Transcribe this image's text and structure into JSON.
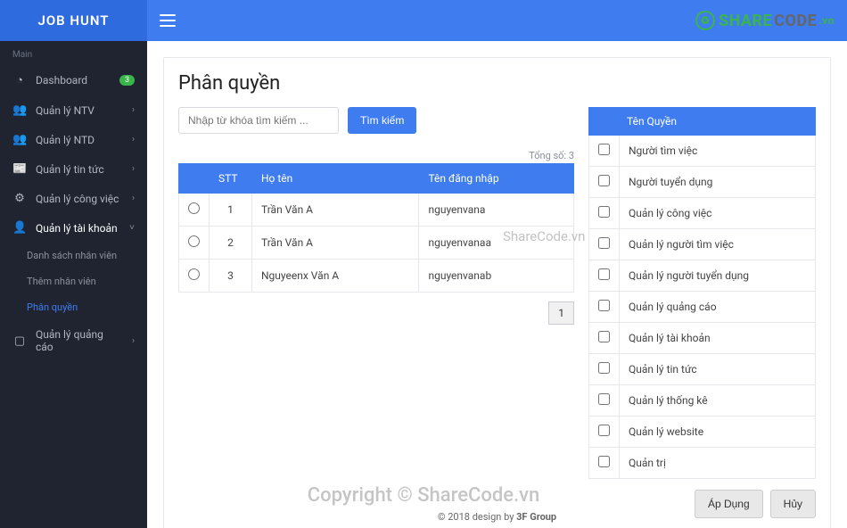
{
  "brand": "JOB HUNT",
  "logo": {
    "share": "SHARE",
    "code": "CODE",
    "vn": ".vn"
  },
  "sidebar": {
    "section": "Main",
    "items": [
      {
        "icon": "dashboard-icon",
        "glyph": "◔",
        "label": "Dashboard",
        "badge": "3"
      },
      {
        "icon": "users-icon",
        "glyph": "👥",
        "label": "Quản lý NTV",
        "chev": "›"
      },
      {
        "icon": "users-icon",
        "glyph": "👥",
        "label": "Quản lý NTD",
        "chev": "›"
      },
      {
        "icon": "news-icon",
        "glyph": "📰",
        "label": "Quản lý tin tức",
        "chev": "›"
      },
      {
        "icon": "gears-icon",
        "glyph": "⚙",
        "label": "Quản lý công việc",
        "chev": "›"
      },
      {
        "icon": "account-icon",
        "glyph": "👤",
        "label": "Quản lý tài khoản",
        "chev": "˅",
        "open": true,
        "sub": [
          {
            "label": "Danh sách nhân viên"
          },
          {
            "label": "Thêm nhân viên"
          },
          {
            "label": "Phân quyền",
            "active": true
          }
        ]
      },
      {
        "icon": "ad-icon",
        "glyph": "▢",
        "label": "Quản lý quảng cáo",
        "chev": "›"
      }
    ]
  },
  "page": {
    "title": "Phân quyền",
    "search_placeholder": "Nhập từ khóa tìm kiếm ...",
    "search_button": "Tìm kiếm",
    "total_label": "Tổng số: 3",
    "user_table": {
      "headers": [
        "",
        "STT",
        "Họ tên",
        "Tên đăng nhập"
      ],
      "rows": [
        {
          "stt": "1",
          "name": "Trần Văn A",
          "username": "nguyenvana"
        },
        {
          "stt": "2",
          "name": "Trần Văn A",
          "username": "nguyenvanaa"
        },
        {
          "stt": "3",
          "name": "Nguyeenx Văn A",
          "username": "nguyenvanab"
        }
      ]
    },
    "pager": {
      "current": "1"
    },
    "perm_table": {
      "headers": [
        "",
        "Tên Quyền"
      ],
      "rows": [
        "Người tìm việc",
        "Người tuyển dụng",
        "Quản lý công việc",
        "Quản lý người tìm việc",
        "Quản lý người tuyển dụng",
        "Quản lý quảng cáo",
        "Quản lý tài khoản",
        "Quản lý tin tức",
        "Quản lý thống kê",
        "Quản lý website",
        "Quản trị"
      ]
    },
    "actions": {
      "apply": "Áp Dụng",
      "cancel": "Hủy"
    }
  },
  "footer": {
    "text": "© 2018 design by ",
    "author": "3F Group"
  },
  "watermarks": {
    "w1": "ShareCode.vn",
    "w2": "Copyright © ShareCode.vn"
  }
}
